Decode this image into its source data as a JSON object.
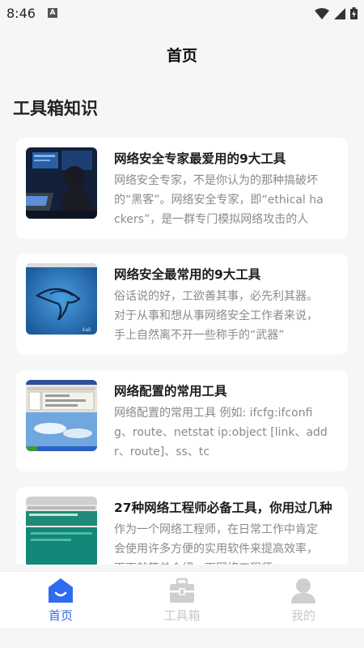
{
  "status_bar": {
    "time": "8:46",
    "notif_letter": "A"
  },
  "header": {
    "title": "首页"
  },
  "section": {
    "title": "工具箱知识"
  },
  "articles": [
    {
      "title": "网络安全专家最爱用的9大工具",
      "desc": "网络安全专家，不是你认为的那种搞破坏的“黑客”。网络安全专家，即“ethical hackers”，是一群专门模拟网络攻击的人"
    },
    {
      "title": "网络安全最常用的9大工具",
      "desc": "俗话说的好，工欲善其事，必先利其器。对于从事和想从事网络安全工作者来说，手上自然离不开一些称手的“武器”"
    },
    {
      "title": "网络配置的常用工具",
      "desc": "网络配置的常用工具 例如: ifcfg:ifconfig、route、netstat ip:object [link、addr、route]、ss、tc"
    },
    {
      "title": "27种网络工程师必备工具，你用过几种",
      "desc": "作为一个网络工程师，在日常工作中肯定会使用许多方便的实用软件来提高效率，下面就简单介绍一下网络工程师"
    }
  ],
  "tabs": [
    {
      "label": "首页",
      "icon": "home-icon",
      "active": true
    },
    {
      "label": "工具箱",
      "icon": "toolbox-icon",
      "active": false
    },
    {
      "label": "我的",
      "icon": "profile-icon",
      "active": false
    }
  ],
  "colors": {
    "accent": "#2f6bf0",
    "inactive": "#c8c8c8",
    "background": "#f6f6f8"
  }
}
